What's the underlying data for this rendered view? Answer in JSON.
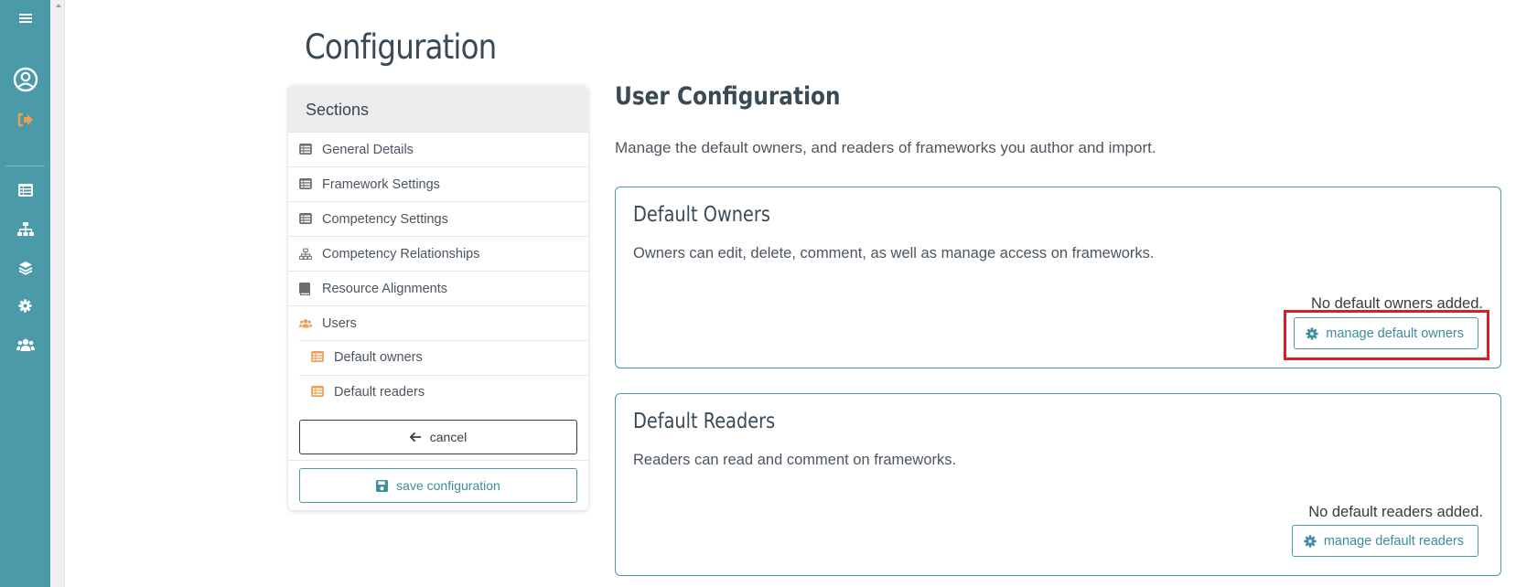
{
  "rail": {
    "icons": [
      "hamburger-menu-icon",
      "user-circle-icon",
      "sign-out-icon",
      "list-icon",
      "sitemap-icon",
      "layers-icon",
      "gear-icon",
      "users-icon"
    ]
  },
  "page": {
    "title": "Configuration"
  },
  "sections": {
    "heading": "Sections",
    "items": [
      {
        "label": "General Details",
        "icon": "list-icon"
      },
      {
        "label": "Framework Settings",
        "icon": "list-icon"
      },
      {
        "label": "Competency Settings",
        "icon": "list-icon"
      },
      {
        "label": "Competency Relationships",
        "icon": "sitemap-icon"
      },
      {
        "label": "Resource Alignments",
        "icon": "book-icon"
      },
      {
        "label": "Users",
        "icon": "users-icon"
      },
      {
        "label": "Default owners",
        "icon": "list-icon"
      },
      {
        "label": "Default readers",
        "icon": "list-icon"
      }
    ],
    "cancel_label": "cancel",
    "save_label": "save configuration"
  },
  "user_config": {
    "title": "User Configuration",
    "description": "Manage the default owners, and readers of frameworks you author and import.",
    "owners": {
      "title": "Default Owners",
      "description": "Owners can edit, delete, comment, as well as manage access on frameworks.",
      "empty": "No default owners added.",
      "button": "manage default owners"
    },
    "readers": {
      "title": "Default Readers",
      "description": "Readers can read and comment on frameworks.",
      "empty": "No default readers added.",
      "button": "manage default readers"
    }
  },
  "colors": {
    "rail": "#4a9aaa",
    "accent": "#4a9aaa",
    "orange": "#e8a055",
    "highlight": "#e11b22"
  }
}
